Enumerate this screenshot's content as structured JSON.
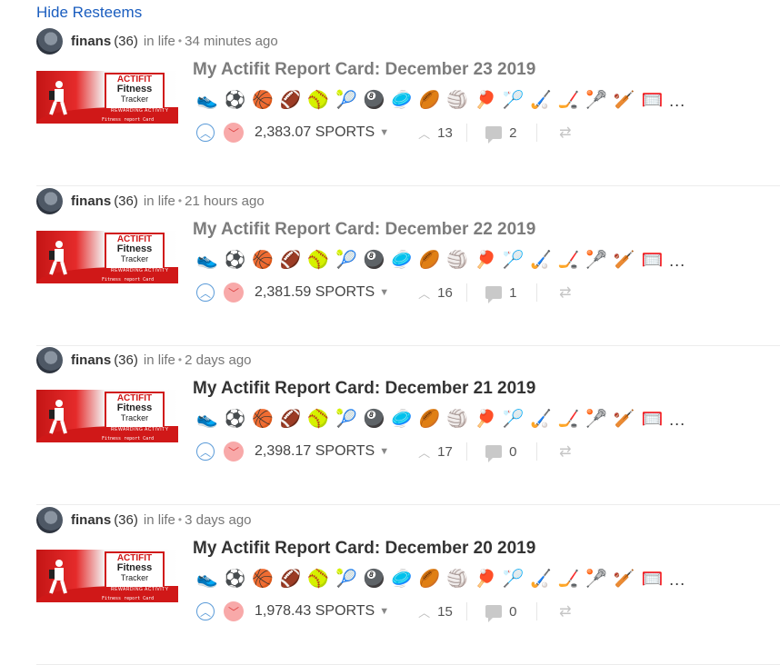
{
  "header": {
    "hide_resteems": "Hide Resteems"
  },
  "tag_icons": [
    "shoe-icon",
    "soccer-ball-icon",
    "basketball-icon",
    "football-icon",
    "softball-icon",
    "tennis-racket-icon",
    "billiard-ball-icon",
    "frisbee-icon",
    "rugby-ball-icon",
    "volleyball-icon",
    "ping-pong-icon",
    "badminton-icon",
    "field-hockey-icon",
    "ice-hockey-icon",
    "lacrosse-icon",
    "cricket-icon",
    "goal-net-icon"
  ],
  "tag_glyphs": [
    "👟",
    "⚽",
    "🏀",
    "🏈",
    "🥎",
    "🎾",
    "🎱",
    "🥏",
    "🏉",
    "🏐",
    "🏓",
    "🏸",
    "🏑",
    "🏒",
    "🥍",
    "🏏",
    "🥅"
  ],
  "more": "...",
  "thumb": {
    "l1": "ACTIFIT",
    "l2": "Fitness",
    "l3": "Tracker",
    "rew": "REWARDING ACTIVITY",
    "foot": "Fitness report Card"
  },
  "posts": [
    {
      "author": "finans",
      "rep": "(36)",
      "category": "in life",
      "time": "34 minutes ago",
      "title": "My Actifit Report Card: December 23 2019",
      "title_muted": true,
      "payout": "2,383.07 SPORTS",
      "votes": "13",
      "comments": "2"
    },
    {
      "author": "finans",
      "rep": "(36)",
      "category": "in life",
      "time": "21 hours ago",
      "title": "My Actifit Report Card: December 22 2019",
      "title_muted": true,
      "payout": "2,381.59 SPORTS",
      "votes": "16",
      "comments": "1"
    },
    {
      "author": "finans",
      "rep": "(36)",
      "category": "in life",
      "time": "2 days ago",
      "title": "My Actifit Report Card: December 21 2019",
      "title_muted": false,
      "payout": "2,398.17 SPORTS",
      "votes": "17",
      "comments": "0"
    },
    {
      "author": "finans",
      "rep": "(36)",
      "category": "in life",
      "time": "3 days ago",
      "title": "My Actifit Report Card: December 20 2019",
      "title_muted": false,
      "payout": "1,978.43 SPORTS",
      "votes": "15",
      "comments": "0"
    }
  ]
}
